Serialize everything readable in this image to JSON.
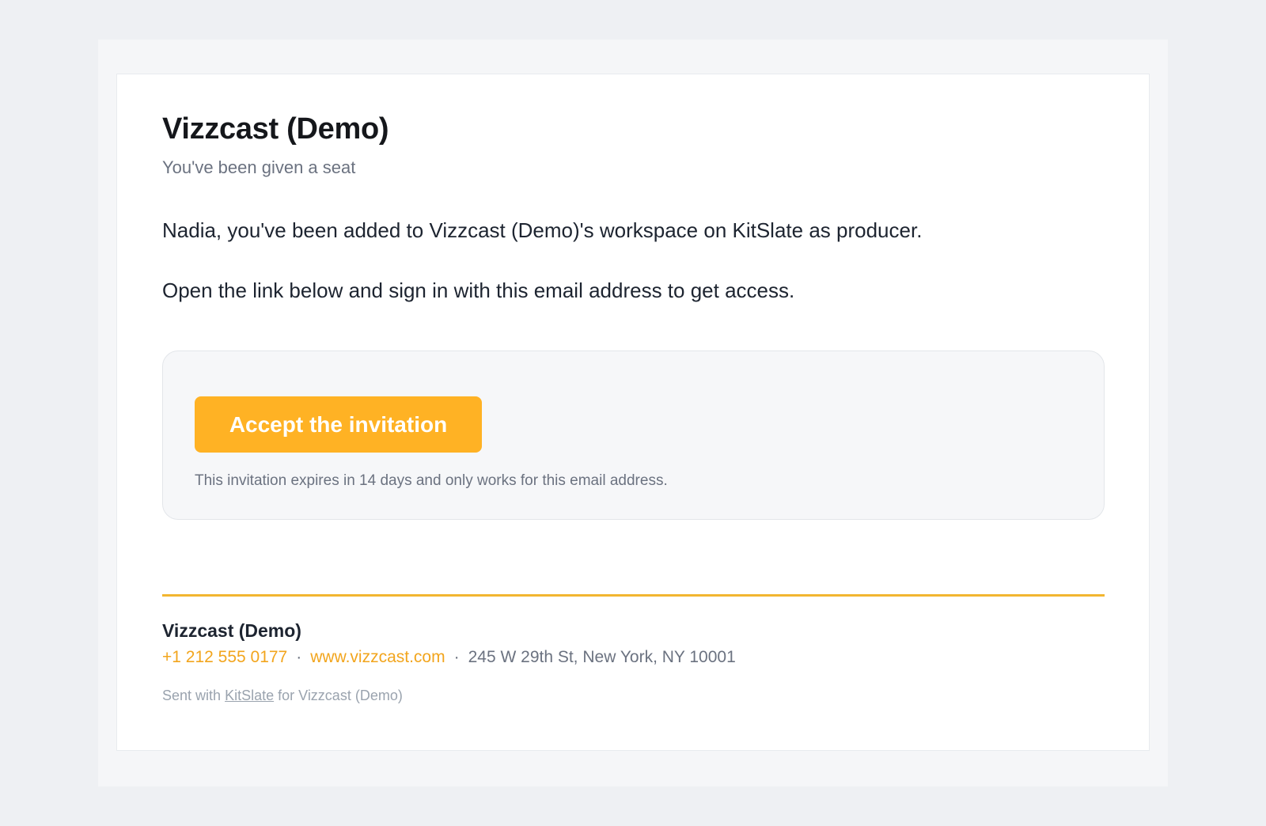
{
  "email": {
    "title": "Vizzcast (Demo)",
    "subtitle": "You've been given a seat",
    "paragraphs": [
      "Nadia, you've been added to Vizzcast (Demo)'s workspace on KitSlate as producer.",
      "Open the link below and sign in with this email address to get access."
    ],
    "invite": {
      "button_label": "Accept the invitation",
      "expiry_note": "This invitation expires in 14 days and only works for this email address."
    },
    "footer": {
      "company": "Vizzcast (Demo)",
      "phone": "+1 212 555 0177",
      "website": "www.vizzcast.com",
      "separator": "·",
      "address": "245 W 29th St, New York, NY 10001",
      "sent_prefix": "Sent with",
      "sent_link": "KitSlate",
      "sent_suffix": "for Vizzcast (Demo)"
    }
  },
  "colors": {
    "accent": "#ffb224",
    "divider": "#f2b630",
    "link": "#f2a51d",
    "page_background": "#eef0f3"
  }
}
